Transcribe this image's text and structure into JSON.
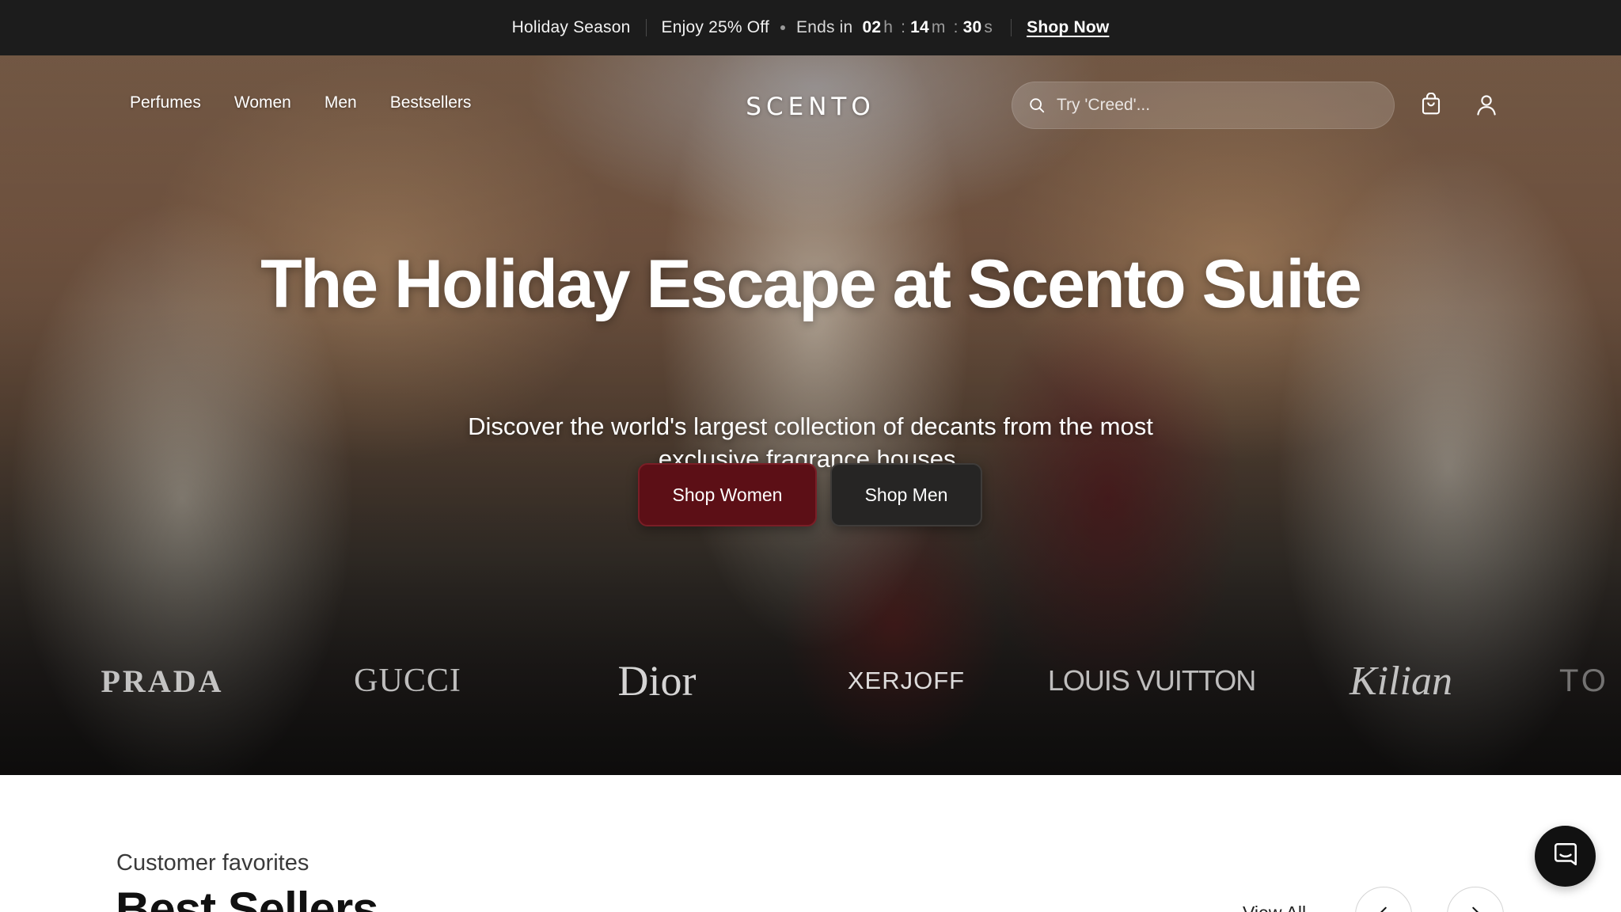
{
  "promo": {
    "season": "Holiday Season",
    "offer": "Enjoy 25% Off",
    "ends_label": "Ends in",
    "countdown": {
      "hours": "02",
      "hours_unit": "h",
      "minutes": "14",
      "minutes_unit": "m",
      "seconds": "30",
      "seconds_unit": "s"
    },
    "shop_now": "Shop Now"
  },
  "nav": {
    "links": [
      "Perfumes",
      "Women",
      "Men",
      "Bestsellers"
    ],
    "logo": "SCENTO",
    "search_placeholder": "Try 'Creed'...",
    "icons": {
      "search": "search-icon",
      "cart": "shopping-bag-icon",
      "account": "user-icon"
    }
  },
  "hero": {
    "headline": "The Holiday Escape at Scento Suite",
    "subheadline": "Discover the world's largest collection of decants from the most exclusive fragrance houses.",
    "cta_women": "Shop Women",
    "cta_men": "Shop Men",
    "colors": {
      "women_button": "#5c0f16",
      "men_button": "#262524"
    }
  },
  "brands": [
    "PRADA",
    "GUCCI",
    "Dior",
    "XERJOFF",
    "LOUIS VUITTON",
    "Kilian",
    "TO"
  ],
  "best_sellers": {
    "eyebrow": "Customer favorites",
    "title": "Best Sellers",
    "view_all": "View All",
    "icons": {
      "prev": "chevron-left-icon",
      "next": "chevron-right-icon"
    }
  },
  "chat": {
    "icon": "chat-icon"
  }
}
